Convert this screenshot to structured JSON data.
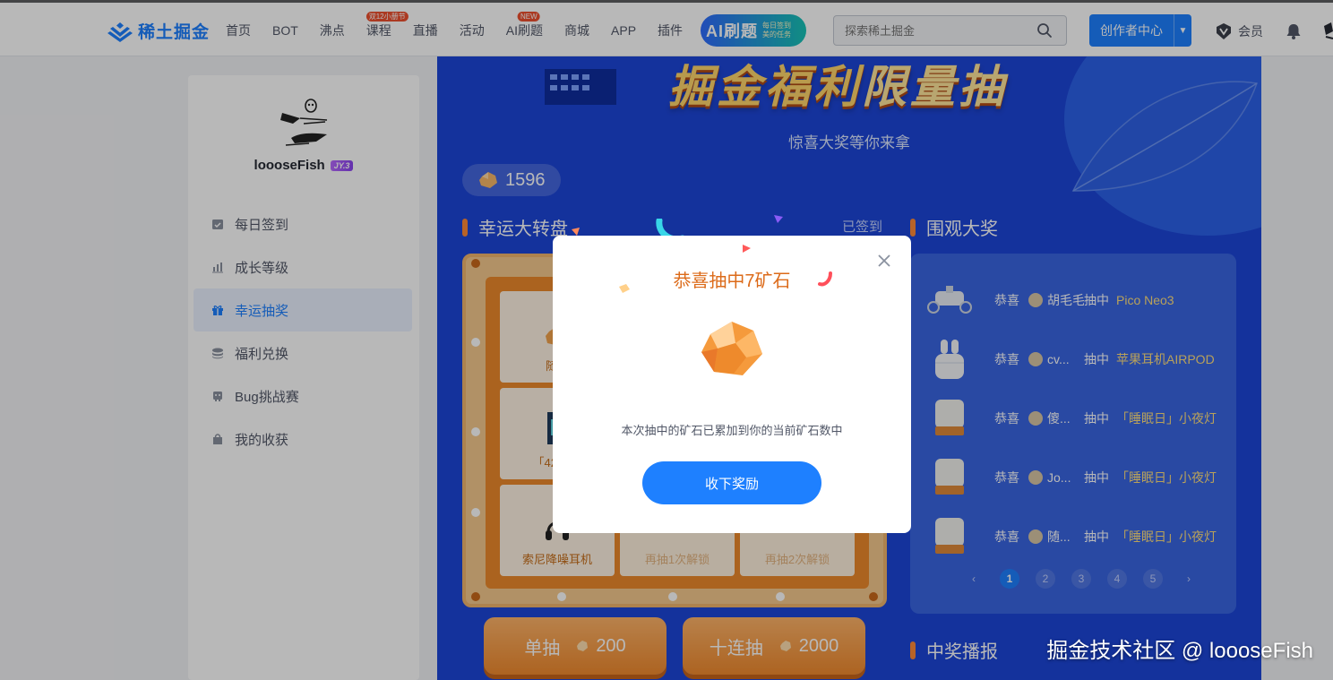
{
  "nav": {
    "logo_text": "稀土掘金",
    "items": [
      {
        "label": "首页"
      },
      {
        "label": "BOT"
      },
      {
        "label": "沸点"
      },
      {
        "label": "课程",
        "badge": "双12小册节"
      },
      {
        "label": "直播"
      },
      {
        "label": "活动"
      },
      {
        "label": "AI刷题",
        "badge": "NEW"
      },
      {
        "label": "商城"
      },
      {
        "label": "APP"
      },
      {
        "label": "插件"
      }
    ],
    "ai_banner": {
      "big": "AI刷题",
      "small": "每日签到 美的任务"
    },
    "search_placeholder": "探索稀土掘金",
    "creator_label": "创作者中心",
    "vip_label": "会员"
  },
  "sidebar": {
    "user_name": "loooseFish",
    "user_level": "JY.3",
    "menu": [
      {
        "label": "每日签到",
        "icon": "calendar-check-icon"
      },
      {
        "label": "成长等级",
        "icon": "bar-chart-icon"
      },
      {
        "label": "幸运抽奖",
        "icon": "gift-icon",
        "active": true
      },
      {
        "label": "福利兑换",
        "icon": "coin-stack-icon"
      },
      {
        "label": "Bug挑战赛",
        "icon": "bug-icon"
      },
      {
        "label": "我的收获",
        "icon": "bag-icon"
      }
    ]
  },
  "lottery": {
    "banner_title": "掘金福利",
    "banner_title_hl": "限量抽",
    "subtitle": "惊喜大奖等你来拿",
    "ore_count": "1596",
    "wheel_title": "幸运大转盘",
    "signed_text": "已签到",
    "cells": [
      {
        "label": "随机",
        "locked": false
      },
      {
        "label": "「4201」",
        "locked": false
      },
      {
        "label": "索尼降噪耳机",
        "locked": false
      },
      {
        "label": "再抽1次解锁",
        "locked": true
      },
      {
        "label": "再抽2次解锁",
        "locked": true
      }
    ],
    "single": {
      "label": "单抽",
      "cost": "200"
    },
    "ten": {
      "label": "十连抽",
      "cost": "2000"
    },
    "watch_title": "围观大奖",
    "winners_title": "中奖播报",
    "watch_rows": [
      {
        "congrats": "恭喜",
        "user": "胡毛毛",
        "hit": "抽中",
        "prize": "Pico Neo3",
        "thumb": "vr-headset-icon"
      },
      {
        "congrats": "恭喜",
        "user": "cv...",
        "hit": "抽中",
        "prize": "苹果耳机AIRPOD",
        "thumb": "airpods-icon"
      },
      {
        "congrats": "恭喜",
        "user": "傻...",
        "hit": "抽中",
        "prize": "「睡眠日」小夜灯",
        "thumb": "night-light-icon"
      },
      {
        "congrats": "恭喜",
        "user": "Jo...",
        "hit": "抽中",
        "prize": "「睡眠日」小夜灯",
        "thumb": "night-light-icon"
      },
      {
        "congrats": "恭喜",
        "user": "随...",
        "hit": "抽中",
        "prize": "「睡眠日」小夜灯",
        "thumb": "night-light-icon"
      }
    ],
    "pager": {
      "prev": "‹",
      "pages": [
        "1",
        "2",
        "3",
        "4",
        "5"
      ],
      "current": "1",
      "next": "›"
    }
  },
  "modal": {
    "title": "恭喜抽中7矿石",
    "desc": "本次抽中的矿石已累加到你的当前矿石数中",
    "button": "收下奖励"
  },
  "watermark": "掘金技术社区 @ loooseFish",
  "colors": {
    "accent": "#1e80ff",
    "lottery_bg": "#1d46d8",
    "orange": "#ee8a2c",
    "modal_title": "#dc6b1a"
  }
}
